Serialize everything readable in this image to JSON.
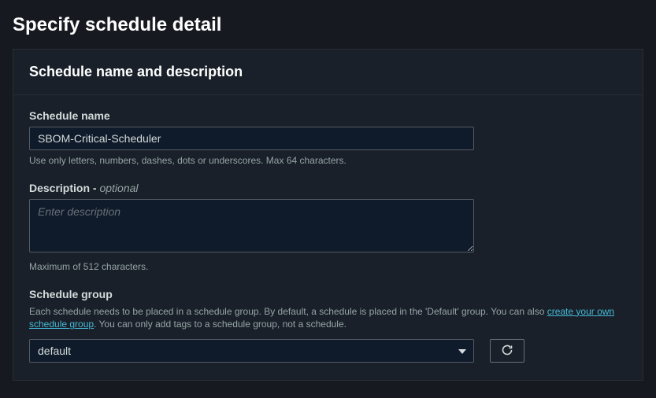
{
  "page": {
    "title": "Specify schedule detail"
  },
  "panel": {
    "title": "Schedule name and description"
  },
  "scheduleName": {
    "label": "Schedule name",
    "value": "SBOM-Critical-Scheduler",
    "hint": "Use only letters, numbers, dashes, dots or underscores. Max 64 characters."
  },
  "description": {
    "label": "Description - ",
    "optional": "optional",
    "placeholder": "Enter description",
    "value": "",
    "hint": "Maximum of 512 characters."
  },
  "scheduleGroup": {
    "label": "Schedule group",
    "hintPrefix": "Each schedule needs to be placed in a schedule group. By default, a schedule is placed in the 'Default' group. You can also ",
    "hintLink": "create your own schedule group",
    "hintSuffix": ". You can only add tags to a schedule group, not a schedule.",
    "selected": "default"
  }
}
